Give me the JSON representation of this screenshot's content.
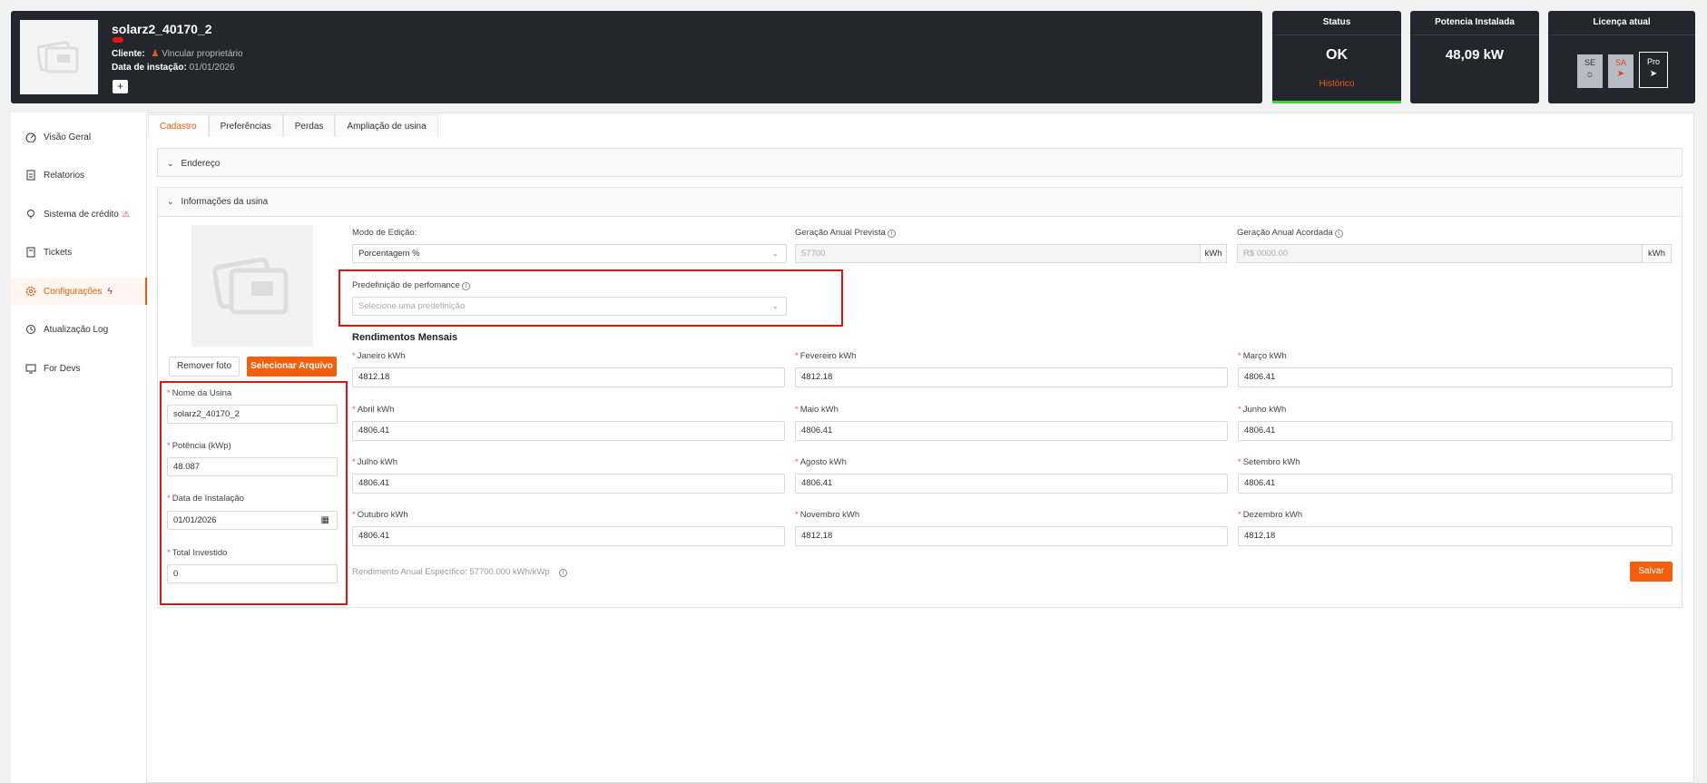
{
  "header": {
    "plant_name": "solarz2_40170_2",
    "client_label": "Cliente:",
    "client_link": "Vincular proprietário",
    "install_label": "Data de instação:",
    "install_date": "01/01/2026",
    "add_label": "+"
  },
  "status_card": {
    "title": "Status",
    "value": "OK",
    "link": "Histórico"
  },
  "power_card": {
    "title": "Potencia Instalada",
    "value": "48,09 kW"
  },
  "license_card": {
    "title": "Licença atual",
    "badges": [
      "SE",
      "SA",
      "Pro"
    ]
  },
  "colors": {
    "accent": "#f05a0e",
    "header_bg": "#23262d",
    "status_ok": "#3fcf3f",
    "highlight_box": "#e81010"
  },
  "sidebar": {
    "items": [
      {
        "label": "Visão Geral",
        "icon": "dashboard-icon"
      },
      {
        "label": "Relatorios",
        "icon": "report-icon"
      },
      {
        "label": "Sistema de crédito",
        "icon": "bulb-icon",
        "badge": "⚠"
      },
      {
        "label": "Tickets",
        "icon": "ticket-icon"
      },
      {
        "label": "Configurações",
        "icon": "gear-icon",
        "badge": "ϟ",
        "active": true
      },
      {
        "label": "Atualização Log",
        "icon": "history-icon"
      },
      {
        "label": "For Devs",
        "icon": "monitor-icon"
      }
    ]
  },
  "tabs": [
    "Cadastro",
    "Preferências",
    "Perdas",
    "Ampliação de usina"
  ],
  "sections": {
    "address": "Endereço",
    "plant_info": "Informações da usina"
  },
  "photo": {
    "remove_label": "Remover foto",
    "select_label": "Selecionar Arquivo"
  },
  "plant_form": {
    "name_label": "Nome da Usina",
    "name_value": "solarz2_40170_2",
    "power_label": "Potência (kWp)",
    "power_value": "48.087",
    "date_label": "Data de Instalação",
    "date_value": "01/01/2026",
    "invest_label": "Total Investido",
    "invest_value": "0"
  },
  "edit_mode": {
    "label": "Modo de Edição:",
    "value": "Porcentagem %"
  },
  "forecast": {
    "label": "Geração Anual Prevista",
    "placeholder": "57700",
    "unit": "kWh"
  },
  "agreed": {
    "label": "Geração Anual Acordada",
    "placeholder": "R$ 0000.00",
    "unit": "kWh"
  },
  "preset": {
    "label": "Predefinição de perfomance",
    "placeholder": "Selecione uma predefinição"
  },
  "monthly": {
    "title": "Rendimentos Mensais",
    "months": [
      {
        "label": "Janeiro kWh",
        "value": "4812.18"
      },
      {
        "label": "Fevereiro kWh",
        "value": "4812.18"
      },
      {
        "label": "Março kWh",
        "value": "4806.41"
      },
      {
        "label": "Abril kWh",
        "value": "4806.41"
      },
      {
        "label": "Maio kWh",
        "value": "4806.41"
      },
      {
        "label": "Junho kWh",
        "value": "4806.41"
      },
      {
        "label": "Julho kWh",
        "value": "4806.41"
      },
      {
        "label": "Agosto kWh",
        "value": "4806.41"
      },
      {
        "label": "Setembro kWh",
        "value": "4806.41"
      },
      {
        "label": "Outubro kWh",
        "value": "4806.41"
      },
      {
        "label": "Novembro kWh",
        "value": "4812.18"
      },
      {
        "label": "Dezembro kWh",
        "value": "4812.18"
      }
    ],
    "annual_specific": "Rendimento Anual Específico: 57700.000 kWh/kWp"
  },
  "save_label": "Salvar"
}
